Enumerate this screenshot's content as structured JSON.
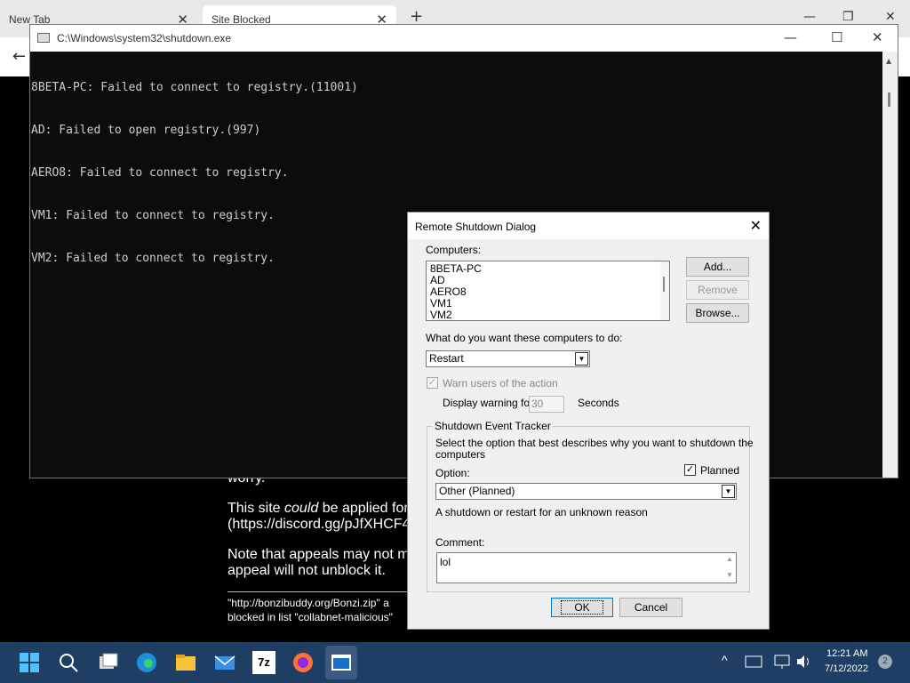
{
  "browser": {
    "tabs": [
      {
        "label": "New Tab"
      },
      {
        "label": "Site Blocked"
      }
    ],
    "new_tab_glyph": "+",
    "close_glyph": "✕",
    "back_glyph": "←",
    "window_controls": {
      "minimize": "—",
      "restore": "❐",
      "close": "✕"
    }
  },
  "blocked_page": {
    "line_worry": "worry.",
    "para1_line1_pre": "This site ",
    "para1_line1_em": "could",
    "para1_line1_post": " be applied for",
    "para1_line2": "(https://discord.gg/pJfXHCF4",
    "para2_line1": "Note that appeals may not m",
    "para2_line2": "appeal will not unblock it.",
    "footer_line1": "\"http://bonzibuddy.org/Bonzi.zip\" a",
    "footer_line2": "blocked in list \"collabnet-malicious\""
  },
  "console": {
    "title": "C:\\Windows\\system32\\shutdown.exe",
    "lines": [
      "8BETA-PC: Failed to connect to registry.(11001)",
      "AD: Failed to open registry.(997)",
      "AERO8: Failed to connect to registry.",
      "VM1: Failed to connect to registry.",
      "VM2: Failed to connect to registry."
    ],
    "controls": {
      "minimize": "—",
      "maximize": "☐",
      "close": "✕"
    }
  },
  "dialog": {
    "title": "Remote Shutdown Dialog",
    "close_glyph": "✕",
    "computers_label": "Computers:",
    "computers": [
      "8BETA-PC",
      "AD",
      "AERO8",
      "VM1",
      "VM2"
    ],
    "add_button": "Add...",
    "remove_button": "Remove",
    "browse_button": "Browse...",
    "action_label": "What do you want these computers to do:",
    "action_value": "Restart",
    "warn_label": "Warn users of the action",
    "warn_checked": true,
    "display_warning_label": "Display warning for",
    "warning_seconds": "30",
    "seconds_label": "Seconds",
    "tracker_title": "Shutdown Event Tracker",
    "tracker_desc_line1": "Select the option that best describes why you want to shutdown the",
    "tracker_desc_line2": "computers",
    "option_label": "Option:",
    "planned_label": "Planned",
    "planned_checked": true,
    "option_value": "Other (Planned)",
    "option_desc": "A shutdown or restart for an unknown reason",
    "comment_label": "Comment:",
    "comment_value": "lol",
    "ok_button": "OK",
    "cancel_button": "Cancel",
    "check_glyph": "✓",
    "dropdown_glyph": "▼"
  },
  "taskbar": {
    "time": "12:21 AM",
    "date": "7/12/2022",
    "notification_count": "2",
    "icons": [
      "windows-start-icon",
      "search-icon",
      "task-view-icon",
      "edge-icon",
      "file-explorer-icon",
      "mail-icon",
      "7zip-icon",
      "firefox-icon",
      "console-app-icon"
    ],
    "sevenzip_label": "7z",
    "tray_chevron": "^"
  },
  "colors": {
    "console_bg": "#0c0c0c",
    "console_text": "#cccccc",
    "taskbar_bg": "#1f3e63",
    "dialog_bg": "#f0f0f0"
  }
}
